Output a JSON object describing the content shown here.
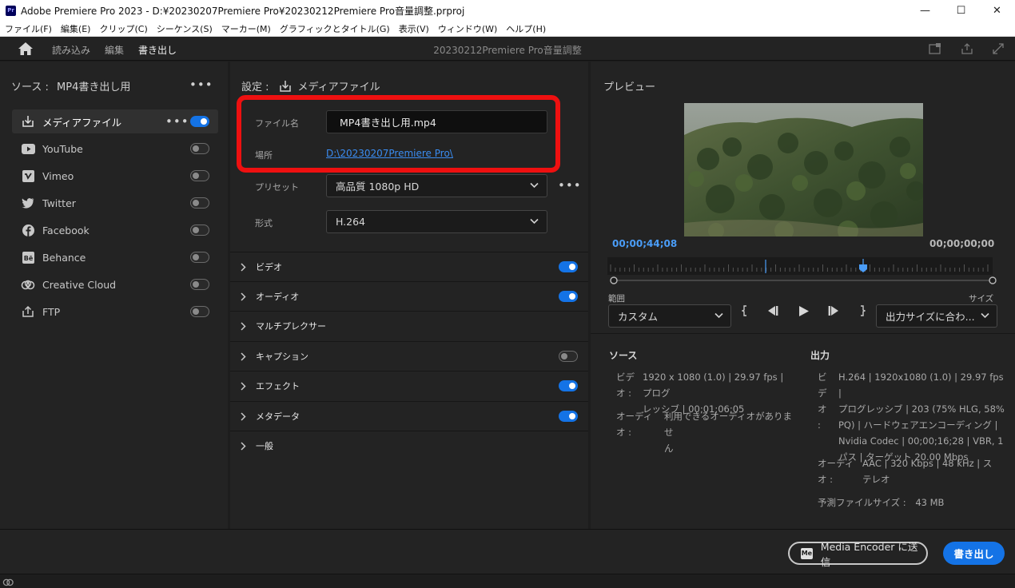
{
  "window": {
    "title": "Adobe Premiere Pro 2023 - D:¥20230207Premiere Pro¥20230212Premiere Pro音量調整.prproj",
    "app_icon": "Pr"
  },
  "menu": [
    "ファイル(F)",
    "編集(E)",
    "クリップ(C)",
    "シーケンス(S)",
    "マーカー(M)",
    "グラフィックとタイトル(G)",
    "表示(V)",
    "ウィンドウ(W)",
    "ヘルプ(H)"
  ],
  "workspace": {
    "tabs": [
      "読み込み",
      "編集",
      "書き出し"
    ],
    "active_tab": "書き出し",
    "project_title": "20230212Premiere Pro音量調整"
  },
  "source": {
    "label": "ソース :",
    "name": "MP4書き出し用",
    "destinations": [
      {
        "label": "メディアファイル",
        "icon": "download-icon",
        "on": true,
        "selected": true
      },
      {
        "label": "YouTube",
        "icon": "youtube-icon",
        "on": false
      },
      {
        "label": "Vimeo",
        "icon": "vimeo-icon",
        "on": false
      },
      {
        "label": "Twitter",
        "icon": "twitter-icon",
        "on": false
      },
      {
        "label": "Facebook",
        "icon": "facebook-icon",
        "on": false
      },
      {
        "label": "Behance",
        "icon": "behance-icon",
        "on": false
      },
      {
        "label": "Creative Cloud",
        "icon": "creative-cloud-icon",
        "on": false
      },
      {
        "label": "FTP",
        "icon": "upload-icon",
        "on": false
      }
    ]
  },
  "settings": {
    "label": "設定 :",
    "target": "メディアファイル",
    "filename_label": "ファイル名",
    "filename": "MP4書き出し用.mp4",
    "location_label": "場所",
    "location": "D:\\20230207Premiere Pro\\",
    "preset_label": "プリセット",
    "preset": "高品質 1080p HD",
    "format_label": "形式",
    "format": "H.264",
    "sections": [
      {
        "label": "ビデオ",
        "toggle": true,
        "on": true
      },
      {
        "label": "オーディオ",
        "toggle": true,
        "on": true
      },
      {
        "label": "マルチプレクサー",
        "toggle": false
      },
      {
        "label": "キャプション",
        "toggle": true,
        "on": false
      },
      {
        "label": "エフェクト",
        "toggle": true,
        "on": true
      },
      {
        "label": "メタデータ",
        "toggle": true,
        "on": true
      },
      {
        "label": "一般",
        "toggle": false
      }
    ]
  },
  "preview": {
    "title": "プレビュー",
    "timecode_current": "00;00;44;08",
    "timecode_end": "00;00;00;00",
    "range_label": "範囲",
    "range_value": "カスタム",
    "size_label": "サイズ",
    "size_value": "出力サイズに合わ...",
    "playhead_fraction": 0.66
  },
  "source_info": {
    "title": "ソース",
    "video_key": "ビデ\nオ :",
    "video_value": "1920 x 1080 (1.0) | 29.97 fps | プログ\nレッシブ | 00;01;06;05",
    "audio_key": "オーディ\nオ :",
    "audio_value": "利用できるオーディオがありませ\nん"
  },
  "output_info": {
    "title": "出力",
    "video_key": "ビ\nデ\nオ :",
    "video_value": "H.264 | 1920x1080 (1.0) | 29.97 fps |\nプログレッシブ | 203 (75% HLG, 58%\nPQ) | ハードウェアエンコーディング |\nNvidia Codec | 00;00;16;28 | VBR, 1\nパス | ターゲット 20.00 Mbps",
    "audio_key": "オーディ\nオ :",
    "audio_value": "AAC | 320 Kbps | 48 kHz | ス\nテレオ",
    "filesize_label": "予測ファイルサイズ :",
    "filesize_value": "43 MB"
  },
  "footer": {
    "media_encoder_button": "Media Encoder に送信",
    "media_encoder_icon": "Me",
    "export_button": "書き出し"
  },
  "colors": {
    "accent": "#1473e6",
    "highlight": "#ee1010",
    "link": "#3a8cf0",
    "timecode": "#4a9df8"
  }
}
